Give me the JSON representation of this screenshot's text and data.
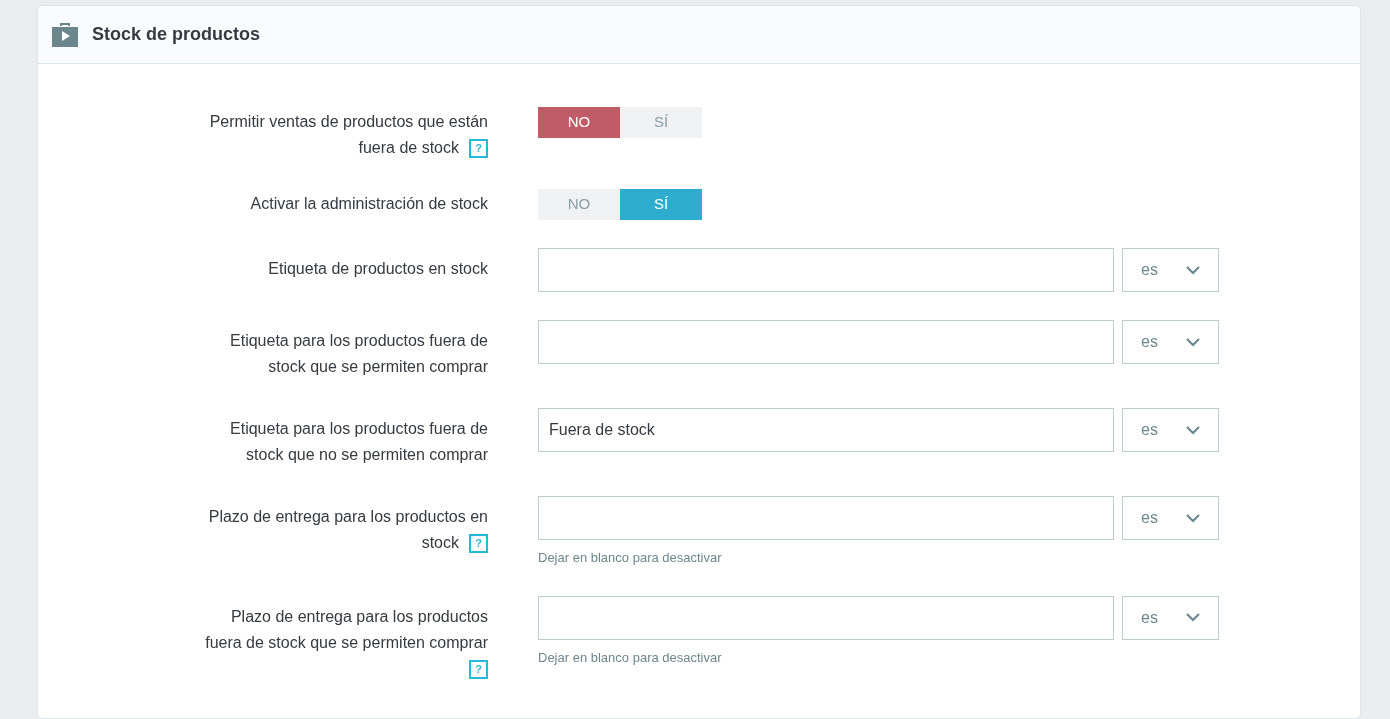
{
  "panel": {
    "title": "Stock de productos"
  },
  "fields": [
    {
      "kind": "toggle",
      "label": "Permitir ventas de productos que están fuera de stock",
      "help": "?",
      "options": [
        {
          "label": "NO",
          "selected": true
        },
        {
          "label": "SÍ",
          "selected": false
        }
      ]
    },
    {
      "kind": "toggle",
      "label": "Activar la administración de stock",
      "options": [
        {
          "label": "NO",
          "selected": false
        },
        {
          "label": "SÍ",
          "selected": true
        }
      ]
    },
    {
      "kind": "text",
      "label": "Etiqueta de productos en stock",
      "language": "es"
    },
    {
      "kind": "text",
      "label": "Etiqueta para los productos fuera de stock que se permiten comprar",
      "language": "es"
    },
    {
      "kind": "text",
      "label": "Etiqueta para los productos fuera de stock que no se permiten comprar",
      "value": "Fuera de stock",
      "language": "es"
    },
    {
      "kind": "text",
      "label": "Plazo de entrega para los productos en stock",
      "help": "?",
      "language": "es",
      "hint": "Dejar en blanco para desactivar"
    },
    {
      "kind": "text",
      "label": "Plazo de entrega para los productos fuera de stock que se permiten comprar",
      "help": "?",
      "language": "es",
      "hint": "Dejar en blanco para desactivar"
    }
  ]
}
